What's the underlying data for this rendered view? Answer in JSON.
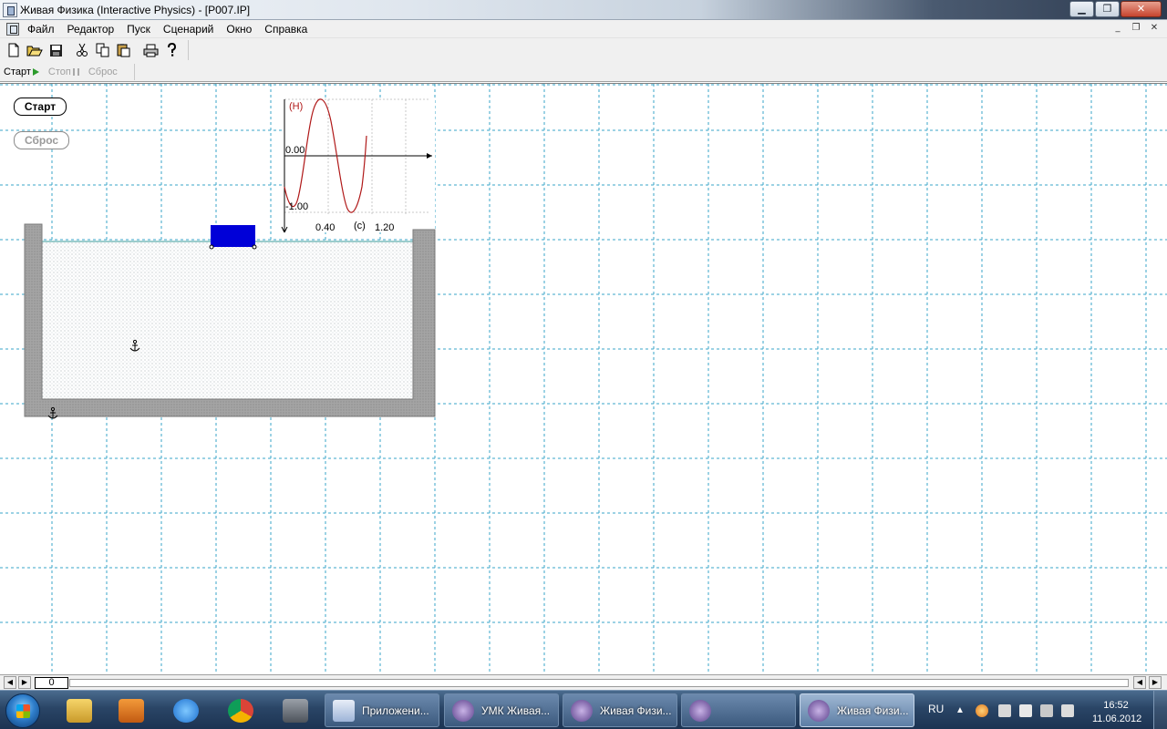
{
  "window": {
    "title": "Живая Физика (Interactive Physics) - [P007.IP]",
    "icon": "interactive-physics-app-icon",
    "controls": {
      "minimize": "minimize-icon",
      "maximize": "maximize-icon",
      "close": "close-icon"
    }
  },
  "menu": {
    "items": [
      {
        "label": "Файл"
      },
      {
        "label": "Редактор"
      },
      {
        "label": "Пуск"
      },
      {
        "label": "Сценарий"
      },
      {
        "label": "Окно"
      },
      {
        "label": "Справка"
      }
    ]
  },
  "toolbar": {
    "icons": [
      "new-icon",
      "open-icon",
      "save-icon",
      "cut-icon",
      "copy-icon",
      "paste-icon",
      "print-icon",
      "help-icon"
    ]
  },
  "runbar": {
    "start_label": "Старт",
    "stop_label": "Стоп",
    "reset_label": "Сброс"
  },
  "workspace": {
    "start_button": "Старт",
    "reset_button": "Сброс",
    "graph": {
      "y_unit": "(Н)",
      "x_unit": "(с)",
      "tick_y_top": "0.00",
      "tick_y_bottom": "-1.00",
      "tick_x_1": "0.40",
      "tick_x_2": "1.20"
    }
  },
  "timeline": {
    "frame": "0"
  },
  "taskbar": {
    "tasks": [
      {
        "label": "Приложени..."
      },
      {
        "label": "УМК Живая..."
      },
      {
        "label": "Живая Физи..."
      },
      {
        "label": ""
      },
      {
        "label": "Живая Физи..."
      }
    ],
    "language": "RU",
    "time": "16:52",
    "date": "11.06.2012"
  },
  "colors": {
    "grid": "#3aa6c8",
    "block": "#0000d8",
    "graph_curve": "#b01818",
    "water_line": "#3a9a9a",
    "wall": "#a6a6a6"
  }
}
